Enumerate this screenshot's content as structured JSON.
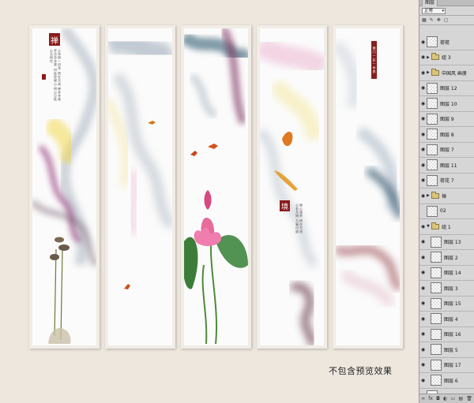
{
  "canvas": {
    "panel1": {
      "seal_char": "禅",
      "poem": "心净则一切净 悟在天成 禅非寻常 非空亦非常 何处是禅心 明心见性 心无所住"
    },
    "panel4": {
      "seal_char": "境",
      "poem": "禅心境界 悟在天成 心若无物 万事可放"
    },
    "panel5": {
      "title": "佛门一花一世界"
    }
  },
  "caption": "不包含预览效果",
  "layers_panel": {
    "tab_label": "图层",
    "blend_mode": "正常",
    "lock_icons": [
      "lock-icon",
      "brush-icon",
      "move-icon",
      "artboard-icon"
    ],
    "layers": [
      {
        "name": "荷荷",
        "type": "layer",
        "thumb": "art",
        "visible": true
      },
      {
        "name": "组 3",
        "type": "group",
        "visible": true
      },
      {
        "name": "中国风 画册",
        "type": "group",
        "visible": true
      },
      {
        "name": "图层 12",
        "type": "layer",
        "visible": true
      },
      {
        "name": "图层 10",
        "type": "layer",
        "visible": true
      },
      {
        "name": "图层 9",
        "type": "layer",
        "visible": true
      },
      {
        "name": "图层 8",
        "type": "layer",
        "visible": true
      },
      {
        "name": "图层 7",
        "type": "layer",
        "visible": true
      },
      {
        "name": "图层 11",
        "type": "layer",
        "visible": true
      },
      {
        "name": "荷花 7",
        "type": "layer",
        "thumb": "art",
        "visible": true
      },
      {
        "name": "禅",
        "type": "group",
        "visible": true
      },
      {
        "name": "02",
        "type": "layer",
        "visible": false
      },
      {
        "name": "组 1",
        "type": "group",
        "open": true,
        "visible": true
      },
      {
        "name": "图层 13",
        "type": "layer",
        "indent": true,
        "visible": true
      },
      {
        "name": "图层 2",
        "type": "layer",
        "indent": true,
        "visible": true
      },
      {
        "name": "图层 14",
        "type": "layer",
        "indent": true,
        "visible": true
      },
      {
        "name": "图层 3",
        "type": "layer",
        "indent": true,
        "visible": true
      },
      {
        "name": "图层 15",
        "type": "layer",
        "indent": true,
        "visible": true
      },
      {
        "name": "图层 4",
        "type": "layer",
        "indent": true,
        "visible": true
      },
      {
        "name": "图层 16",
        "type": "layer",
        "indent": true,
        "visible": true
      },
      {
        "name": "图层 5",
        "type": "layer",
        "indent": true,
        "visible": true
      },
      {
        "name": "图层 17",
        "type": "layer",
        "indent": true,
        "visible": true
      },
      {
        "name": "图层 6",
        "type": "layer",
        "indent": true,
        "visible": true
      },
      {
        "name": "背景",
        "type": "background",
        "visible": false
      }
    ],
    "bottom_icons": [
      "link-icon",
      "fx-icon",
      "mask-icon",
      "adjustment-icon",
      "folder-icon",
      "new-layer-icon",
      "trash-icon"
    ],
    "bottom_labels": [
      "∞",
      "fx",
      "◘",
      "◐",
      "▭",
      "▤",
      "🗑"
    ]
  }
}
